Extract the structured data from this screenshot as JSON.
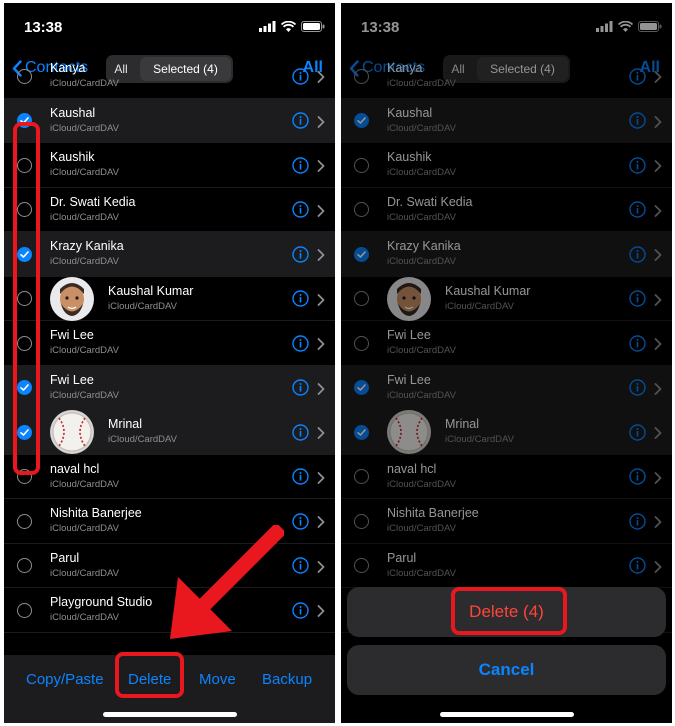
{
  "status": {
    "time": "13:38"
  },
  "nav": {
    "back_label": "Contacts",
    "seg_all": "All",
    "seg_selected": "Selected (4)",
    "all_button": "All"
  },
  "contacts": [
    {
      "name": "Kanya",
      "sub": "iCloud/CardDAV",
      "selected": false,
      "avatar": ""
    },
    {
      "name": "Kaushal",
      "sub": "iCloud/CardDAV",
      "selected": true,
      "avatar": ""
    },
    {
      "name": "Kaushik",
      "sub": "iCloud/CardDAV",
      "selected": false,
      "avatar": ""
    },
    {
      "name": "Dr. Swati Kedia",
      "sub": "iCloud/CardDAV",
      "selected": false,
      "avatar": ""
    },
    {
      "name": "Krazy Kanika",
      "sub": "iCloud/CardDAV",
      "selected": true,
      "avatar": ""
    },
    {
      "name": "Kaushal Kumar",
      "sub": "iCloud/CardDAV",
      "selected": false,
      "avatar": "memoji"
    },
    {
      "name": "Fwi Lee",
      "sub": "iCloud/CardDAV",
      "selected": false,
      "avatar": ""
    },
    {
      "name": "Fwi Lee",
      "sub": "iCloud/CardDAV",
      "selected": true,
      "avatar": ""
    },
    {
      "name": "Mrinal",
      "sub": "iCloud/CardDAV",
      "selected": true,
      "avatar": "baseball"
    },
    {
      "name": "naval hcl",
      "sub": "iCloud/CardDAV",
      "selected": false,
      "avatar": ""
    },
    {
      "name": "Nishita Banerjee",
      "sub": "iCloud/CardDAV",
      "selected": false,
      "avatar": ""
    },
    {
      "name": "Parul",
      "sub": "iCloud/CardDAV",
      "selected": false,
      "avatar": ""
    },
    {
      "name": "Playground Studio",
      "sub": "iCloud/CardDAV",
      "selected": false,
      "avatar": ""
    }
  ],
  "toolbar": {
    "copy_paste": "Copy/Paste",
    "delete": "Delete",
    "move": "Move",
    "backup": "Backup"
  },
  "action_sheet": {
    "delete_label": "Delete (4)",
    "cancel_label": "Cancel"
  },
  "colors": {
    "accent": "#0a84ff",
    "destructive": "#ff453a",
    "highlight": "#e8181e",
    "background": "#000000"
  }
}
